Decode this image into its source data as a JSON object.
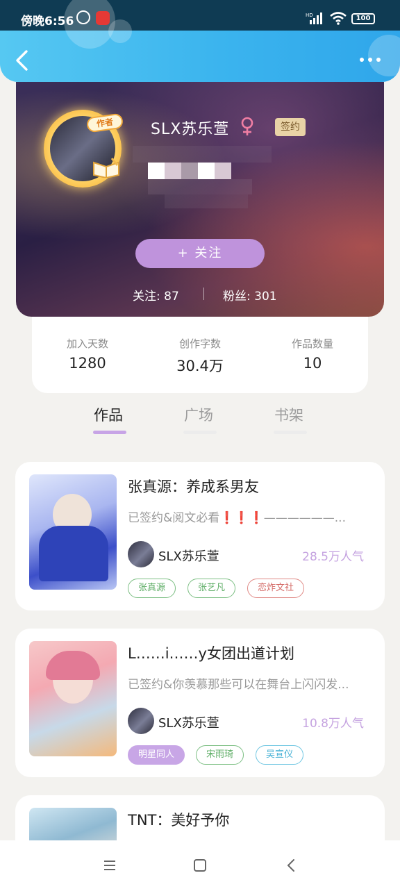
{
  "status_bar": {
    "time": "傍晚6:56",
    "battery": "100",
    "hd_label": "HD"
  },
  "app_bar": {
    "back_icon": "back-arrow-icon",
    "more_icon": "more-dots-icon"
  },
  "profile": {
    "username": "SLX苏乐萱",
    "gender": "female",
    "gender_symbol": "♀",
    "author_badge": "作者",
    "signed_badge": "签约",
    "follow_button": "+ 关注",
    "following": "关注: 87",
    "followers": "粉丝: 301"
  },
  "stats": [
    {
      "label": "加入天数",
      "value": "1280"
    },
    {
      "label": "创作字数",
      "value": "30.4万"
    },
    {
      "label": "作品数量",
      "value": "10"
    }
  ],
  "tabs": [
    {
      "label": "作品",
      "active": true
    },
    {
      "label": "广场",
      "active": false
    },
    {
      "label": "书架",
      "active": false
    }
  ],
  "works": [
    {
      "title": "张真源：养成系男友",
      "desc": "已签约&阅文必看❗❗❗——————...",
      "author": "SLX苏乐萱",
      "popularity": "28.5万人气",
      "tags": [
        {
          "label": "张真源",
          "style": "green"
        },
        {
          "label": "张艺凡",
          "style": "green"
        },
        {
          "label": "恋炸文社",
          "style": "red"
        }
      ]
    },
    {
      "title": "L……i……y女团出道计划",
      "desc": "已签约&你羡慕那些可以在舞台上闪闪发...",
      "author": "SLX苏乐萱",
      "popularity": "10.8万人气",
      "tags": [
        {
          "label": "明星同人",
          "style": "purple"
        },
        {
          "label": "宋雨琦",
          "style": "green"
        },
        {
          "label": "吴宣仪",
          "style": "cyan"
        }
      ]
    },
    {
      "title": "TNT：美好予你"
    }
  ],
  "nav": {
    "menu_icon": "menu-icon",
    "home_icon": "home-square-icon",
    "back_icon": "nav-back-icon"
  },
  "colors": {
    "header": "#3bb4ee",
    "accent_purple": "#bf93dc",
    "popularity": "#c5a3e0",
    "tab_underline_active": "#c7a4e6"
  }
}
